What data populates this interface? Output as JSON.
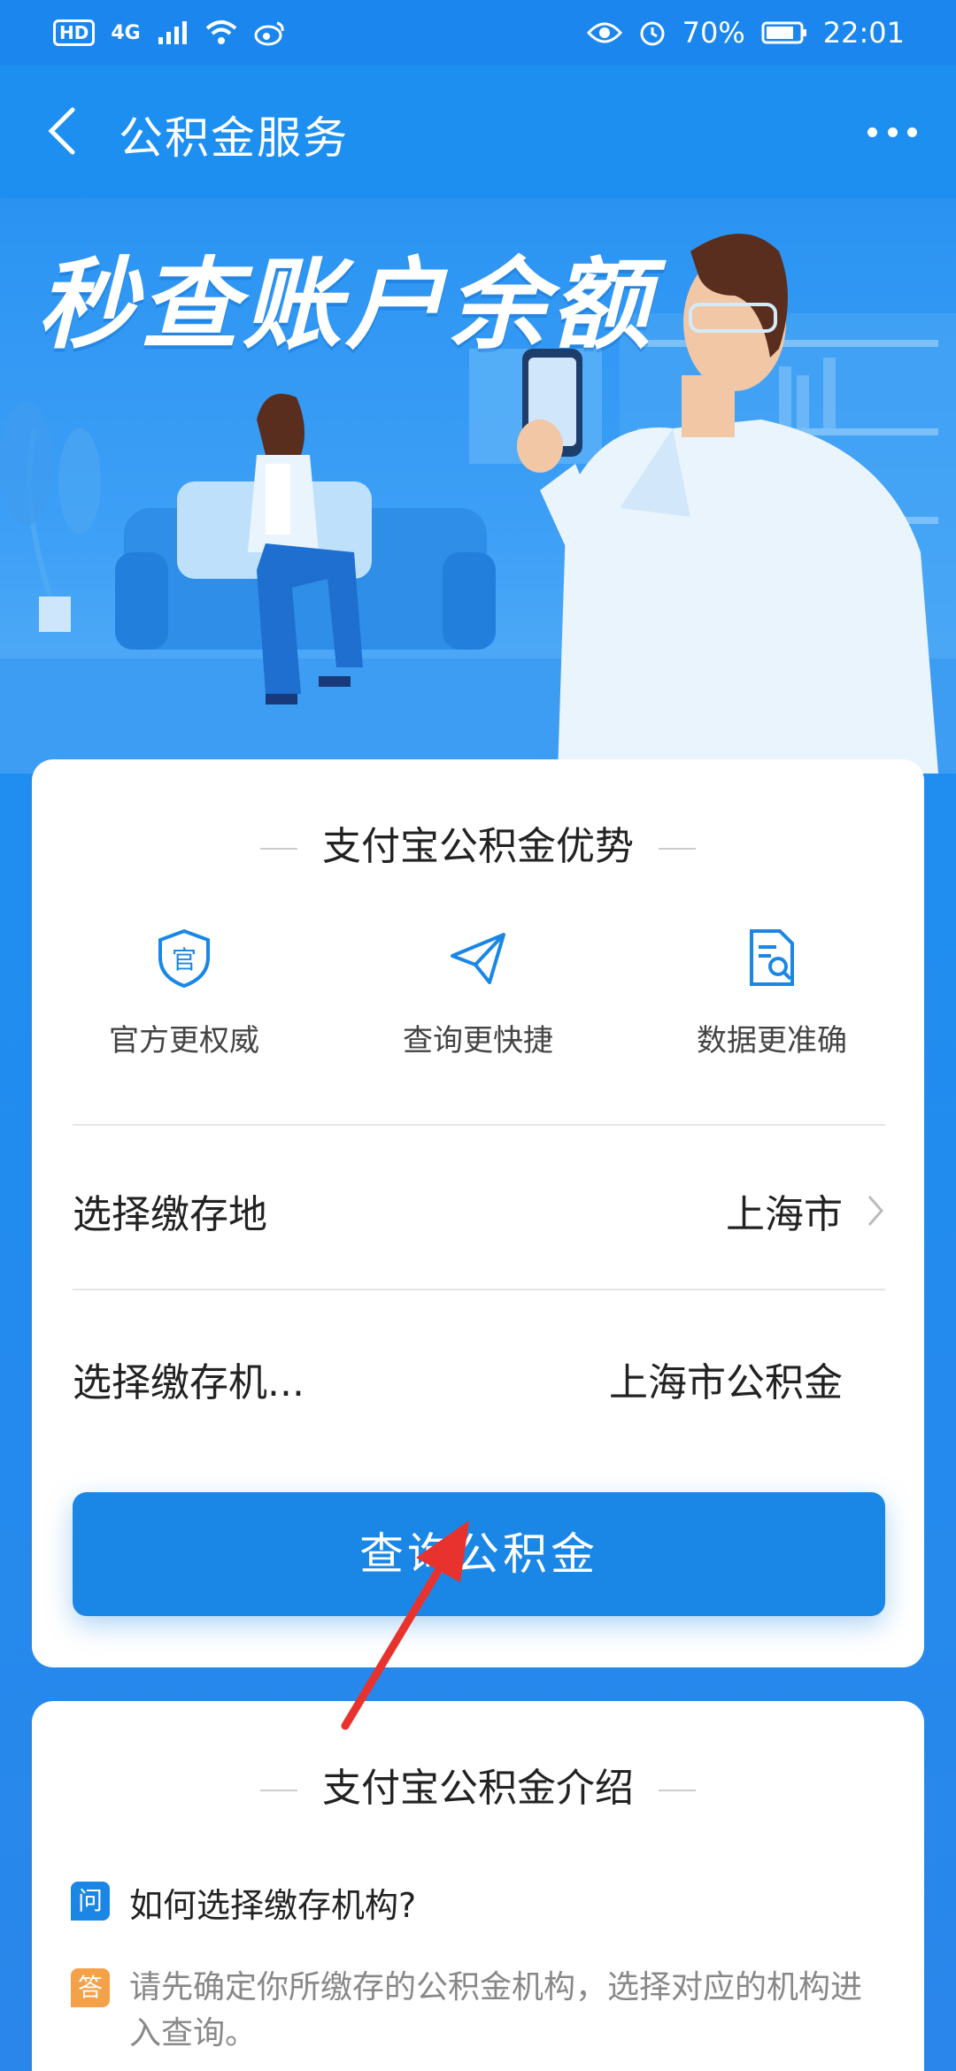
{
  "status_bar": {
    "hd": "HD",
    "signal": "4G",
    "battery": "70%",
    "time": "22:01"
  },
  "nav": {
    "title": "公积金服务"
  },
  "hero": {
    "title": "秒查账户余额"
  },
  "advantages": {
    "heading": "支付宝公积金优势",
    "features": [
      {
        "label": "官方更权威",
        "icon": "shield-icon"
      },
      {
        "label": "查询更快捷",
        "icon": "paper-plane-icon"
      },
      {
        "label": "数据更准确",
        "icon": "document-search-icon"
      }
    ]
  },
  "form": {
    "location_label": "选择缴存地",
    "location_value": "上海市",
    "institution_label": "选择缴存机...",
    "institution_value": "上海市公积金",
    "query_button": "查询公积金"
  },
  "intro": {
    "heading": "支付宝公积金介绍",
    "q_badge": "问",
    "a_badge": "答",
    "question": "如何选择缴存机构?",
    "answer": "请先确定你所缴存的公积金机构，选择对应的机构进入查询。"
  },
  "colors": {
    "primary": "#1a87e6",
    "q_badge": "#1a87e6",
    "a_badge": "#f5a14a",
    "annotation_arrow": "#e8322e"
  }
}
